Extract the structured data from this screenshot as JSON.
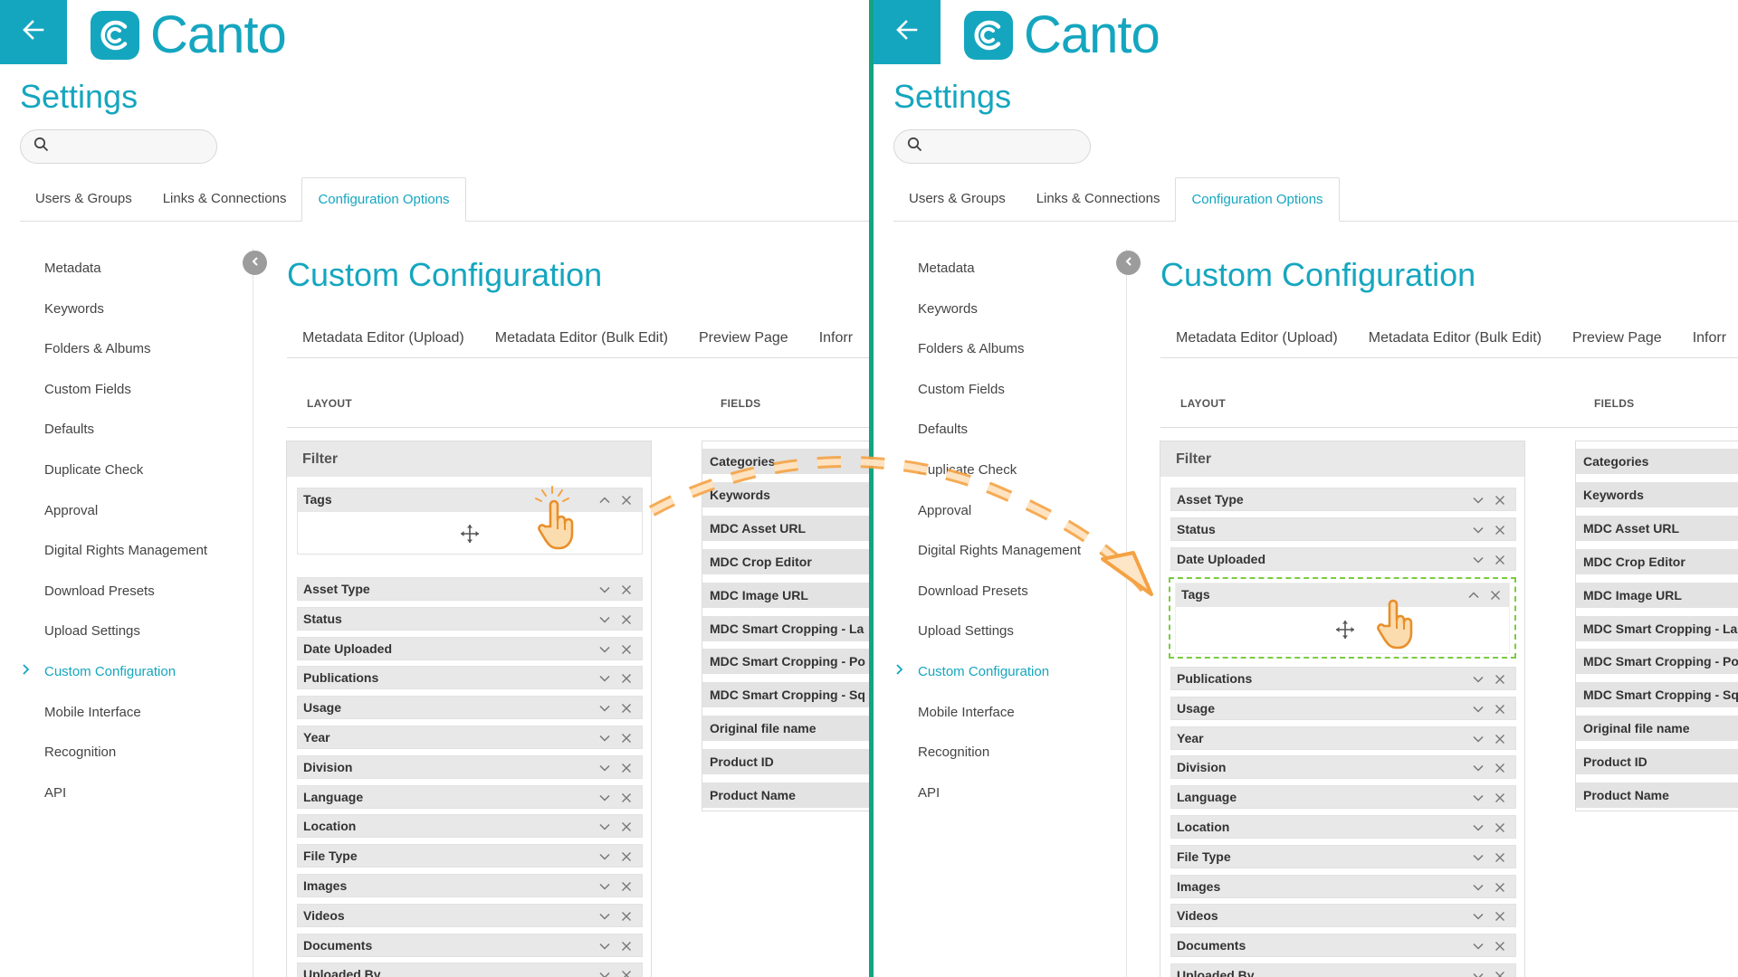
{
  "brand": {
    "name": "Canto",
    "color": "#15a6bf",
    "divider_color": "#13a382"
  },
  "settings_title": "Settings",
  "search": {
    "placeholder": ""
  },
  "tabs": [
    "Users & Groups",
    "Links & Connections",
    "Configuration Options"
  ],
  "active_tab": "Configuration Options",
  "sidebar": {
    "items": [
      "Metadata",
      "Keywords",
      "Folders & Albums",
      "Custom Fields",
      "Defaults",
      "Duplicate Check",
      "Approval",
      "Digital Rights Management",
      "Download Presets",
      "Upload Settings",
      "Custom Configuration",
      "Mobile Interface",
      "Recognition",
      "API"
    ],
    "active": "Custom Configuration"
  },
  "main_title": "Custom Configuration",
  "subtabs": [
    "Metadata Editor (Upload)",
    "Metadata Editor (Bulk Edit)",
    "Preview Page",
    "Inforr"
  ],
  "columns": {
    "layout": "LAYOUT",
    "fields": "FIELDS"
  },
  "layout_group": "Filter",
  "fields_list": [
    "Categories",
    "Keywords",
    "MDC Asset URL",
    "MDC Crop Editor",
    "MDC Image URL",
    "MDC Smart Cropping - La",
    "MDC Smart Cropping - Po",
    "MDC Smart Cropping - Sq",
    "Original file name",
    "Product ID",
    "Product Name"
  ],
  "before": {
    "expanded_field": "Tags",
    "layout_fields": [
      "Asset Type",
      "Status",
      "Date Uploaded",
      "Publications",
      "Usage",
      "Year",
      "Division",
      "Language",
      "Location",
      "File Type",
      "Images",
      "Videos",
      "Documents",
      "Uploaded By"
    ]
  },
  "after": {
    "fields_above": [
      "Asset Type",
      "Status",
      "Date Uploaded"
    ],
    "dropped_field": "Tags",
    "fields_below": [
      "Publications",
      "Usage",
      "Year",
      "Division",
      "Language",
      "Location",
      "File Type",
      "Images",
      "Videos",
      "Documents",
      "Uploaded By"
    ]
  },
  "icons": {
    "back": "arrow-left-icon",
    "search": "search-icon",
    "collapse": "chevron-left-icon",
    "expand": "chevron-down-icon",
    "collapse_field": "chevron-up-icon",
    "remove": "close-icon",
    "move": "move-icon",
    "pointer": "hand-pointer-icon",
    "active_indicator": "chevron-right-icon"
  },
  "annotation": {
    "arrow_color": "#f5a243",
    "drop_zone_color": "#7ccb41"
  }
}
